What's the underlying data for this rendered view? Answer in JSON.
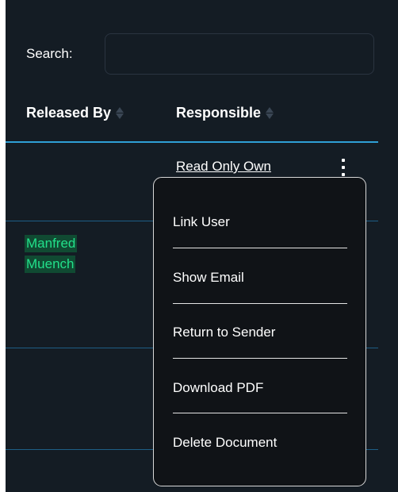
{
  "search": {
    "label": "Search:",
    "value": "",
    "placeholder": ""
  },
  "table": {
    "columns": [
      {
        "label": "Released By"
      },
      {
        "label": "Responsible"
      }
    ],
    "rows": [
      {
        "released_by": "",
        "responsible": "Read Only Own"
      },
      {
        "released_by_first": "Manfred",
        "released_by_last": "Muench",
        "responsible": ""
      }
    ]
  },
  "context_menu": {
    "items": [
      {
        "label": "Link User"
      },
      {
        "label": "Show Email"
      },
      {
        "label": "Return to Sender"
      },
      {
        "label": "Download PDF"
      },
      {
        "label": "Delete Document"
      }
    ]
  },
  "colors": {
    "background": "#141c24",
    "header_rule": "#2f9fd6",
    "row_rule": "#1e5e86",
    "highlight_text": "#22e08a",
    "highlight_bg": "#104a32",
    "menu_bg": "#101317"
  },
  "icons": {
    "sort": "sort-icon",
    "kebab": "kebab-menu-icon"
  }
}
